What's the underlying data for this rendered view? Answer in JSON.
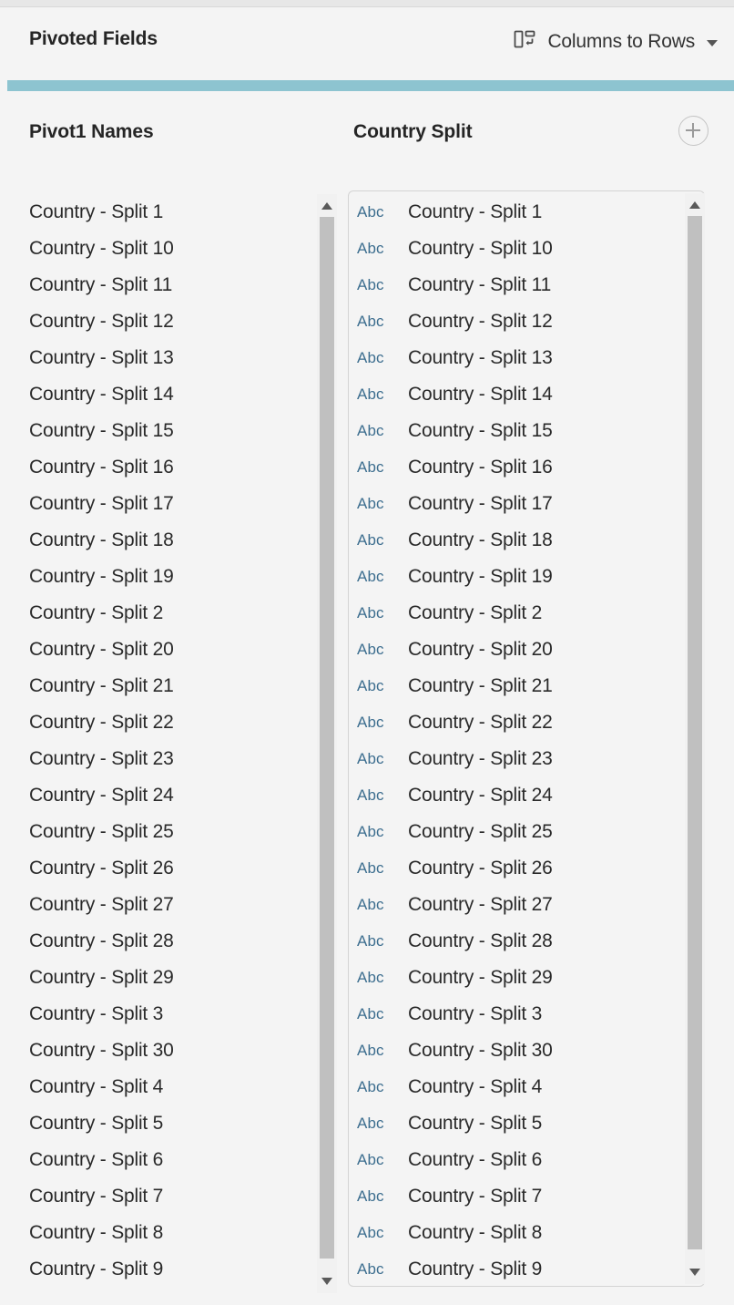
{
  "window": {
    "top_strip_color": "#e7e7e7"
  },
  "header": {
    "title": "Pivoted Fields",
    "pivot_mode": {
      "icon": "columns-to-rows-icon",
      "label": "Columns to Rows",
      "caret": "chevron-down-icon"
    },
    "accent_color": "#8dc4d0"
  },
  "columns": {
    "left_header": "Pivot1 Names",
    "right_header": "Country Split",
    "add_button_icon": "plus-circle-icon"
  },
  "left_list": {
    "rows": [
      "Country - Split 1",
      "Country - Split 10",
      "Country - Split 11",
      "Country - Split 12",
      "Country - Split 13",
      "Country - Split 14",
      "Country - Split 15",
      "Country - Split 16",
      "Country - Split 17",
      "Country - Split 18",
      "Country - Split 19",
      "Country - Split 2",
      "Country - Split 20",
      "Country - Split 21",
      "Country - Split 22",
      "Country - Split 23",
      "Country - Split 24",
      "Country - Split 25",
      "Country - Split 26",
      "Country - Split 27",
      "Country - Split 28",
      "Country - Split 29",
      "Country - Split 3",
      "Country - Split 30",
      "Country - Split 4",
      "Country - Split 5",
      "Country - Split 6",
      "Country - Split 7",
      "Country - Split 8",
      "Country - Split 9"
    ],
    "scrollbar": {
      "up_arrow": "scroll-up-arrow-icon",
      "down_arrow": "scroll-down-arrow-icon"
    }
  },
  "right_list": {
    "type_label": "Abc",
    "type_label_color": "#3d6e8f",
    "rows": [
      "Country - Split 1",
      "Country - Split 10",
      "Country - Split 11",
      "Country - Split 12",
      "Country - Split 13",
      "Country - Split 14",
      "Country - Split 15",
      "Country - Split 16",
      "Country - Split 17",
      "Country - Split 18",
      "Country - Split 19",
      "Country - Split 2",
      "Country - Split 20",
      "Country - Split 21",
      "Country - Split 22",
      "Country - Split 23",
      "Country - Split 24",
      "Country - Split 25",
      "Country - Split 26",
      "Country - Split 27",
      "Country - Split 28",
      "Country - Split 29",
      "Country - Split 3",
      "Country - Split 30",
      "Country - Split 4",
      "Country - Split 5",
      "Country - Split 6",
      "Country - Split 7",
      "Country - Split 8",
      "Country - Split 9"
    ],
    "scrollbar": {
      "up_arrow": "scroll-up-arrow-icon",
      "down_arrow": "scroll-down-arrow-icon"
    }
  }
}
